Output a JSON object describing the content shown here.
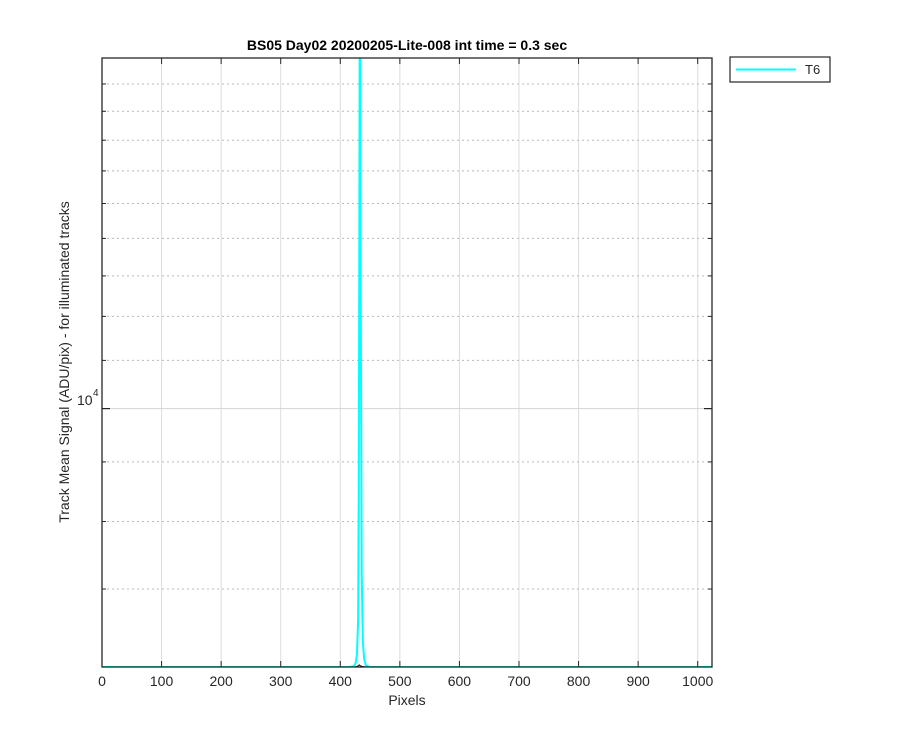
{
  "chart_data": {
    "type": "line",
    "title": "BS05 Day02 20200205-Lite-008 int time = 0.3 sec",
    "xlabel": "Pixels",
    "ylabel": "Track Mean Signal (ADU/pix) - for illuminated tracks",
    "xlim": [
      0,
      1024
    ],
    "ylim": [
      6000,
      20000
    ],
    "yscale": "log",
    "grid": true,
    "legend_position": "outside-top-right",
    "x_ticks": [
      0,
      100,
      200,
      300,
      400,
      500,
      600,
      700,
      800,
      900,
      1000
    ],
    "x_tick_labels": [
      "0",
      "100",
      "200",
      "300",
      "400",
      "500",
      "600",
      "700",
      "800",
      "900",
      "1000"
    ],
    "y_major_tick": {
      "value": 10000,
      "base": "10",
      "exponent": "4"
    },
    "y_minor_ticks": [
      7000,
      8000,
      9000,
      11000,
      12000,
      13000,
      14000,
      15000,
      16000,
      17000,
      18000,
      19000,
      20000
    ],
    "series": [
      {
        "name": "T6",
        "color": "#00ffff",
        "x": [
          0,
          415,
          423,
          426,
          428,
          430,
          431,
          432,
          433,
          434,
          436,
          438,
          440,
          443,
          450,
          1024
        ],
        "y": [
          6000,
          6000,
          6010,
          6050,
          6150,
          6600,
          8500,
          14000,
          30000,
          14000,
          7200,
          6300,
          6100,
          6020,
          6000,
          6000
        ]
      }
    ],
    "background_traces": [
      {
        "color": "#000000",
        "x": [
          0,
          420,
          426,
          430,
          432,
          434,
          438,
          444,
          1024
        ],
        "y": [
          6000,
          6000,
          6003,
          6012,
          6025,
          6012,
          6004,
          6000,
          6000
        ]
      }
    ]
  }
}
